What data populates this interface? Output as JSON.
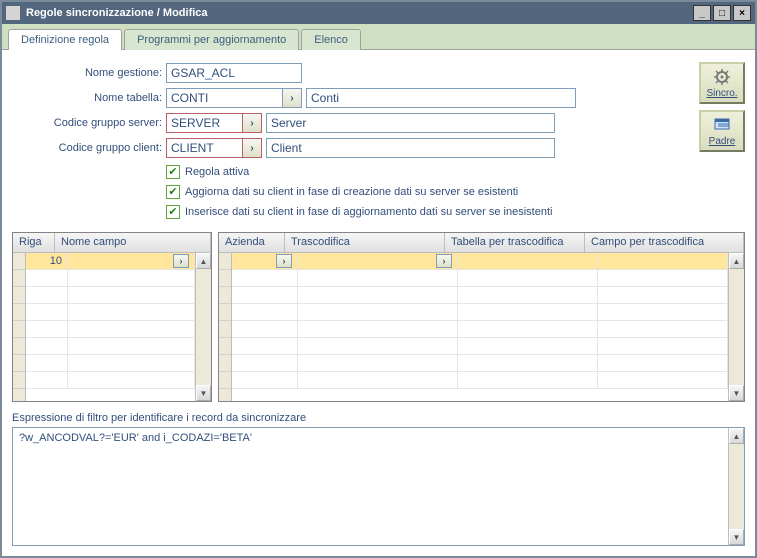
{
  "window": {
    "title": "Regole sincronizzazione / Modifica"
  },
  "tabs": {
    "t0": "Definizione regola",
    "t1": "Programmi per aggiornamento",
    "t2": "Elenco"
  },
  "labels": {
    "nome_gestione": "Nome gestione:",
    "nome_tabella": "Nome tabella:",
    "codice_gruppo_server": "Codice gruppo server:",
    "codice_gruppo_client": "Codice gruppo client:"
  },
  "values": {
    "nome_gestione": "GSAR_ACL",
    "nome_tabella": "CONTI",
    "nome_tabella_desc": "Conti",
    "codice_gruppo_server": "SERVER",
    "codice_gruppo_server_desc": "Server",
    "codice_gruppo_client": "CLIENT",
    "codice_gruppo_client_desc": "Client"
  },
  "checkboxes": {
    "regola_attiva": "Regola attiva",
    "aggiorna_dati": "Aggiorna dati su client in fase di creazione dati su server se esistenti",
    "inserisce_dati": "Inserisce dati su client in fase di aggiornamento dati su server se inesistenti"
  },
  "buttons": {
    "sincro": "Sincro.",
    "padre": "Padre"
  },
  "left_table": {
    "col_riga": "Riga",
    "col_nome_campo": "Nome campo",
    "row0_riga": "10"
  },
  "right_table": {
    "col_azienda": "Azienda",
    "col_trascodifica": "Trascodifica",
    "col_tabella": "Tabella per trascodifica",
    "col_campo": "Campo per trascodifica"
  },
  "filter": {
    "label": "Espressione di filtro per identificare i record da sincronizzare",
    "value": "?w_ANCODVAL?='EUR' and i_CODAZI='BETA'"
  }
}
